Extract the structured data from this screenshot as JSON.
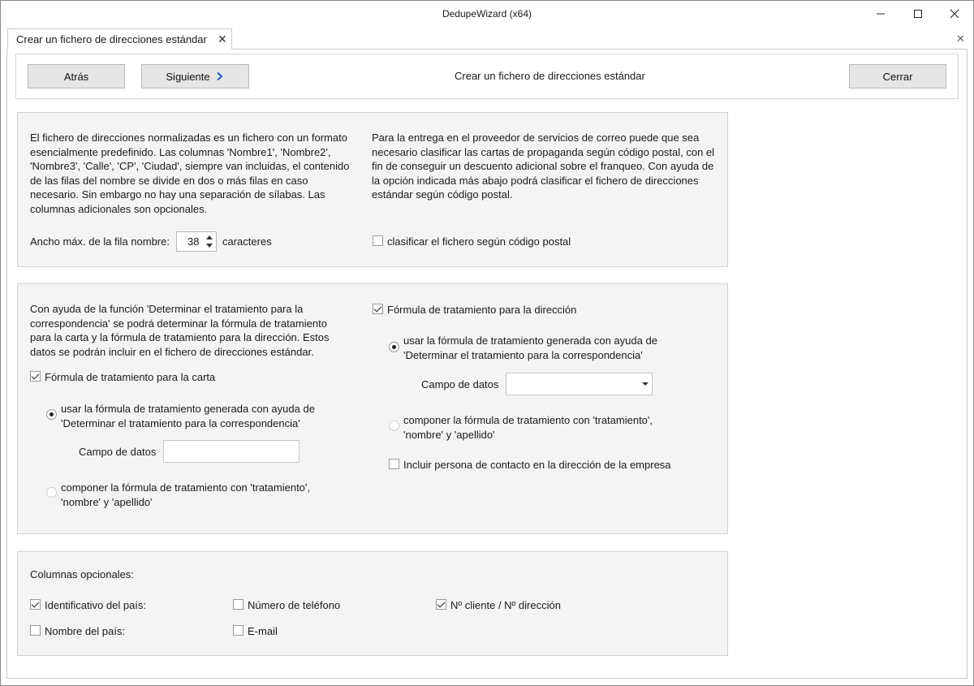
{
  "window": {
    "title": "DedupeWizard  (x64)",
    "minimize_symbol": "—",
    "maximize_symbol": "☐",
    "close_symbol": "✕"
  },
  "tab": {
    "label": "Crear un fichero de direcciones estándar",
    "close_symbol": "✕"
  },
  "panel_close_symbol": "✕",
  "toolbar": {
    "back_label": "Atrás",
    "next_label": "Siguiente",
    "next_icon": "chevron-right-icon",
    "title": "Crear un fichero de direcciones estándar",
    "close_label": "Cerrar"
  },
  "section1": {
    "description": "El fichero de direcciones normalizadas es un fichero con un formato esencialmente predefinido. Las columnas 'Nombre1', 'Nombre2', 'Nombre3', 'Calle', 'CP', 'Ciudad', siempre van incluidas, el contenido de las filas del nombre se divide en dos o más filas en caso necesario. Sin embargo no hay una separación de sílabas. Las columnas adicionales son opcionales.",
    "max_width_label": "Ancho máx. de la fila nombre:",
    "max_width_value": "38",
    "max_width_unit": "caracteres",
    "sort_description": "Para la entrega en el proveedor de servicios de correo puede que sea necesario clasificar las cartas de propaganda según código postal, con el fin de conseguir un descuento adicional sobre el franqueo. Con ayuda de la opción indicada más abajo podrá clasificar el fichero de direcciones estándar según código postal.",
    "sort_checkbox_label": "clasificar el fichero según código postal",
    "sort_checked": false
  },
  "section2": {
    "description": "Con ayuda de la función 'Determinar el tratamiento para la correspondencia' se podrá determinar la fórmula de tratamiento para la carta y la fórmula de tratamiento para la dirección. Estos datos se podrán incluir en el fichero de direcciones estándar.",
    "letter": {
      "checkbox_label": "Fórmula de tratamiento para la carta",
      "checked": true,
      "radio_generated_line1": "usar la fórmula de tratamiento  generada con ayuda de",
      "radio_generated_line2": "'Determinar el tratamiento para la correspondencia'",
      "data_field_label": "Campo de datos",
      "data_field_value": "",
      "radio_compose_line1": "componer la fórmula de tratamiento con 'tratamiento',",
      "radio_compose_line2": "'nombre' y 'apellido'",
      "selected": "generated"
    },
    "address": {
      "checkbox_label": "Fórmula de tratamiento para la dirección",
      "checked": true,
      "radio_generated_line1": "usar la fórmula de tratamiento  generada con ayuda de",
      "radio_generated_line2": "'Determinar el tratamiento para la correspondencia'",
      "data_field_label": "Campo de datos",
      "data_field_value": "",
      "radio_compose_line1": "componer la fórmula de tratamiento con 'tratamiento',",
      "radio_compose_line2": "'nombre' y 'apellido'",
      "selected": "generated",
      "contact_label": "Incluir persona de contacto en la dirección de la empresa",
      "contact_checked": false
    }
  },
  "section3": {
    "title": "Columnas opcionales:",
    "options": [
      {
        "label": "Identificativo del país:",
        "checked": true
      },
      {
        "label": "Número de teléfono",
        "checked": false
      },
      {
        "label": "Nº cliente / Nº dirección",
        "checked": true
      },
      {
        "label": "Nombre del país:",
        "checked": false
      },
      {
        "label": "E-mail",
        "checked": false
      }
    ]
  }
}
